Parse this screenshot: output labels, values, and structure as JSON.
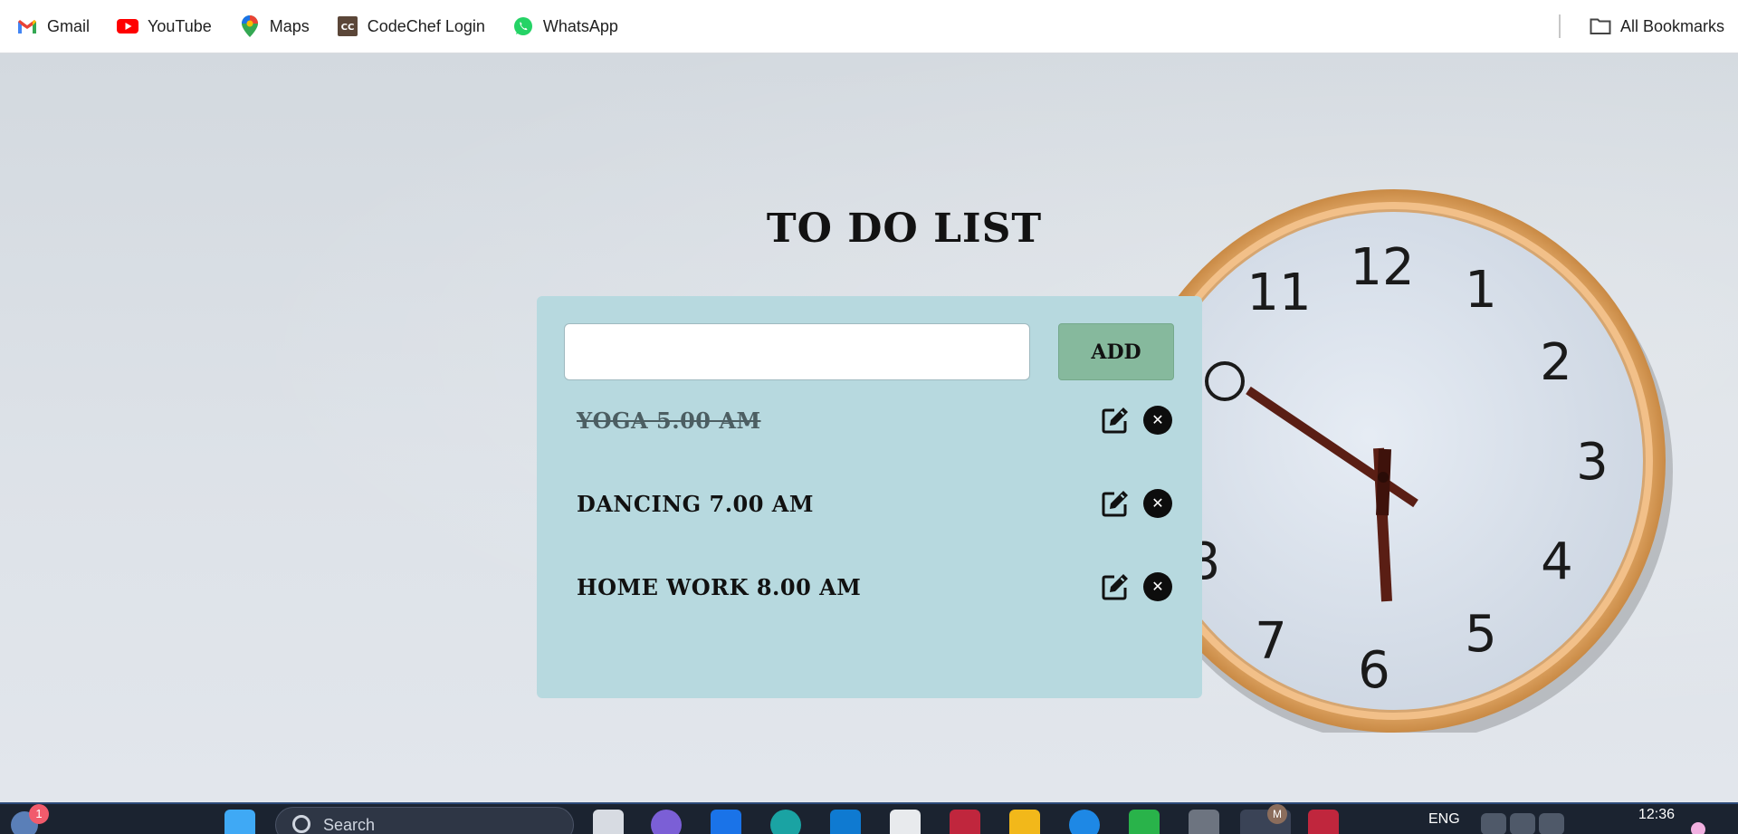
{
  "bookmarks": {
    "items": [
      {
        "label": "Gmail",
        "icon": "gmail-icon"
      },
      {
        "label": "YouTube",
        "icon": "youtube-icon"
      },
      {
        "label": "Maps",
        "icon": "maps-icon"
      },
      {
        "label": "CodeChef Login",
        "icon": "codechef-icon"
      },
      {
        "label": "WhatsApp",
        "icon": "whatsapp-icon"
      }
    ],
    "all_label": "All Bookmarks"
  },
  "app": {
    "title": "TO DO LIST",
    "input_value": "",
    "add_label": "ADD",
    "tasks": [
      {
        "text": "YOGA 5.00 AM",
        "done": true
      },
      {
        "text": "DANCING 7.00 AM",
        "done": false
      },
      {
        "text": "HOME WORK 8.00 AM",
        "done": false
      }
    ]
  },
  "taskbar": {
    "weather_badge": "1",
    "search_placeholder": "Search",
    "language": "ENG",
    "time": "12:36",
    "chrome_profile_badge": "M"
  },
  "colors": {
    "card_bg": "#b7d9df",
    "add_button": "#86b99d",
    "wall": "#d8dde3",
    "clock_frame": "#e2a867"
  }
}
